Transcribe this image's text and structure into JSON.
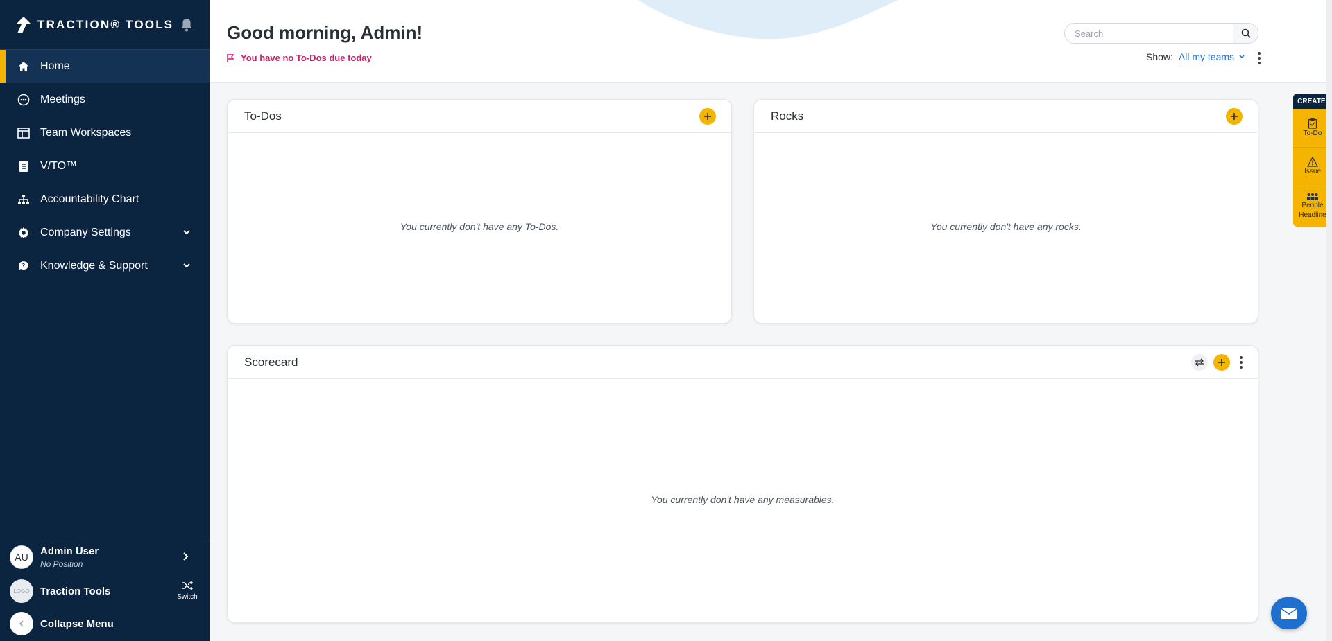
{
  "brand": {
    "name": "TRACTION® TOOLS"
  },
  "sidebar": {
    "items": [
      {
        "label": "Home",
        "icon": "home-icon",
        "active": true
      },
      {
        "label": "Meetings",
        "icon": "meetings-icon"
      },
      {
        "label": "Team Workspaces",
        "icon": "workspace-icon"
      },
      {
        "label": "V/TO™",
        "icon": "document-icon"
      },
      {
        "label": "Accountability Chart",
        "icon": "org-chart-icon"
      },
      {
        "label": "Company Settings",
        "icon": "gear-icon",
        "expandable": true
      },
      {
        "label": "Knowledge & Support",
        "icon": "support-icon",
        "expandable": true
      }
    ],
    "user": {
      "initials": "AU",
      "name": "Admin User",
      "position": "No Position"
    },
    "company": {
      "logo_text": "LOGO",
      "name": "Traction Tools",
      "switch_label": "Switch"
    },
    "collapse_label": "Collapse Menu"
  },
  "header": {
    "greeting": "Good morning, Admin!",
    "todo_note": "You have no To-Dos due today",
    "search": {
      "placeholder": "Search"
    },
    "show_label": "Show:",
    "show_value": "All my teams"
  },
  "cards": {
    "todos": {
      "title": "To-Dos",
      "empty": "You currently don't have any To-Dos."
    },
    "rocks": {
      "title": "Rocks",
      "empty": "You currently don't have any rocks."
    },
    "scorecard": {
      "title": "Scorecard",
      "empty": "You currently don't have any measurables."
    }
  },
  "create_panel": {
    "title": "CREATE:",
    "items": [
      {
        "label": "To-Do",
        "icon": "clipboard-icon"
      },
      {
        "label": "Issue",
        "icon": "warning-icon"
      },
      {
        "label": "People Headline",
        "icon": "people-icon"
      }
    ]
  },
  "colors": {
    "sidebar": "#0b2440",
    "accent": "#f5b400",
    "alert": "#d8196b",
    "link": "#2a73d3"
  }
}
